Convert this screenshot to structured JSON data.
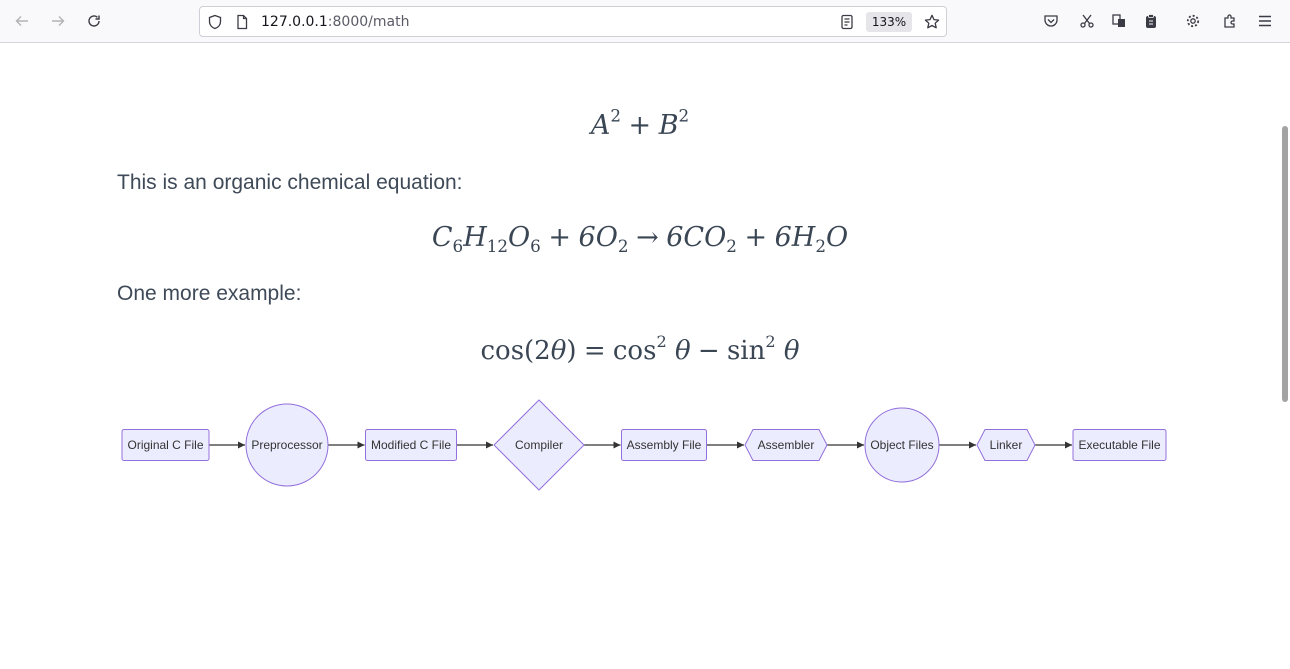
{
  "browser": {
    "url_host": "127.0.0.1",
    "url_rest": ":8000/math",
    "zoom": "133%"
  },
  "page": {
    "eq1": {
      "a": "A",
      "b": "B",
      "exp": "2",
      "plus": "+"
    },
    "para1": "This is an organic chemical equation:",
    "eq2": {
      "t1": "C",
      "s1": "6",
      "t2": "H",
      "s2": "12",
      "t3": "O",
      "s3": "6",
      "plus1": "+",
      "t4": "6O",
      "s4": "2",
      "arrow": "→",
      "t5": "6CO",
      "s5": "2",
      "plus2": "+",
      "t6": "6H",
      "s6": "2",
      "t7": "O"
    },
    "para2": "One more example:",
    "eq3": {
      "lhs": "cos(2",
      "theta": "θ",
      "rparen": ")",
      "eq": "=",
      "cos": "cos",
      "exp": "2",
      "minus": "−",
      "sin": "sin"
    }
  },
  "flowchart": {
    "nodes": [
      {
        "id": "original",
        "label": "Original C File",
        "shape": "rect"
      },
      {
        "id": "preprocessor",
        "label": "Preprocessor",
        "shape": "circle"
      },
      {
        "id": "modified",
        "label": "Modified C File",
        "shape": "rect"
      },
      {
        "id": "compiler",
        "label": "Compiler",
        "shape": "diamond"
      },
      {
        "id": "assembly",
        "label": "Assembly File",
        "shape": "rect"
      },
      {
        "id": "assembler",
        "label": "Assembler",
        "shape": "hexagon"
      },
      {
        "id": "object",
        "label": "Object Files",
        "shape": "circle"
      },
      {
        "id": "linker",
        "label": "Linker",
        "shape": "hexagon"
      },
      {
        "id": "executable",
        "label": "Executable File",
        "shape": "rect"
      }
    ],
    "colors": {
      "fill": "#ececff",
      "stroke": "#9370db",
      "edge": "#333333"
    }
  }
}
